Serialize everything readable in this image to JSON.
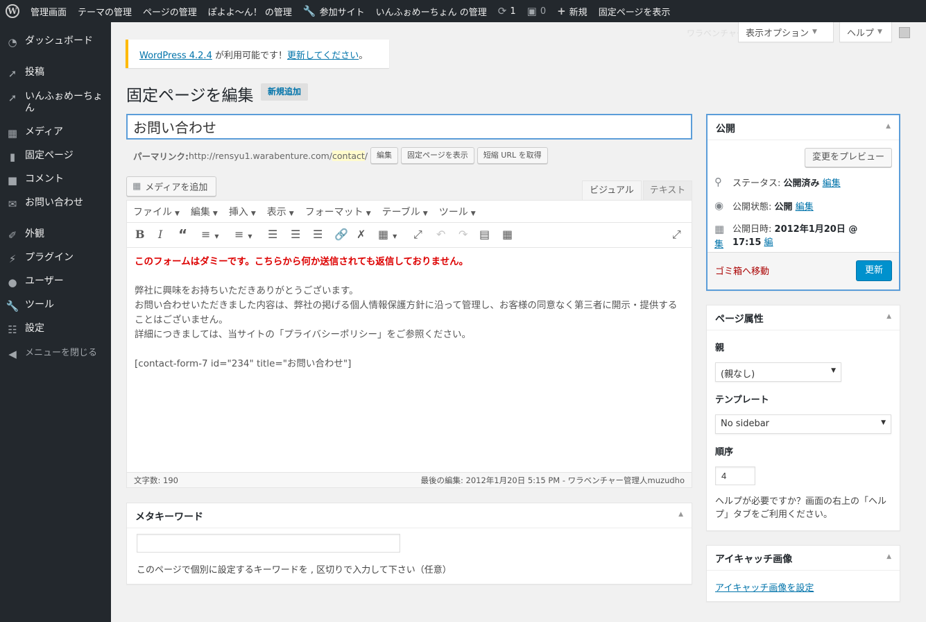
{
  "adminbar": {
    "wp_logo": "W",
    "dashboard": "管理画面",
    "theme": "テーマの管理",
    "pages": "ページの管理",
    "site": "ぽよよ〜ん！ の管理",
    "join": "参加サイト",
    "info": "いんふぉめーちょん の管理",
    "updates_count": "1",
    "comments_count": "0",
    "new": "新規",
    "view_page": "固定ページを表示"
  },
  "screen_options": {
    "label": "表示オプション",
    "help": "ヘルプ",
    "ghost_text": "ワラベンチャー管理人 muzudho さん"
  },
  "sidebar": {
    "items": [
      {
        "label": "ダッシュボード",
        "icon": "dashboard-icon"
      },
      {
        "label": "投稿",
        "icon": "pin-icon"
      },
      {
        "label": "いんふぉめーちょん",
        "icon": "pin-icon"
      },
      {
        "label": "メディア",
        "icon": "media-icon"
      },
      {
        "label": "固定ページ",
        "icon": "page-icon"
      },
      {
        "label": "コメント",
        "icon": "comment-icon"
      },
      {
        "label": "お問い合わせ",
        "icon": "mail-icon"
      },
      {
        "label": "外観",
        "icon": "brush-icon"
      },
      {
        "label": "プラグイン",
        "icon": "plugin-icon"
      },
      {
        "label": "ユーザー",
        "icon": "user-icon"
      },
      {
        "label": "ツール",
        "icon": "wrench-icon"
      },
      {
        "label": "設定",
        "icon": "settings-icon"
      },
      {
        "label": "メニューを閉じる",
        "icon": "collapse-icon"
      }
    ]
  },
  "notice": {
    "link": "WordPress 4.2.4",
    "text": " が利用可能です！",
    "update_link": "更新してください",
    "end": "。"
  },
  "page": {
    "title": "固定ページを編集",
    "add_new": "新規追加"
  },
  "post_title": "お問い合わせ",
  "permalink": {
    "label": "パーマリンク:",
    "base": " http://rensyu1.warabenture.com/",
    "slug": "contact",
    "trail": "/",
    "edit": "編集",
    "view": "固定ページを表示",
    "shortlink": "短縮 URL を取得"
  },
  "editor": {
    "add_media": "メディアを追加",
    "tab_visual": "ビジュアル",
    "tab_text": "テキスト",
    "menus": [
      "ファイル",
      "編集",
      "挿入",
      "表示",
      "フォーマット",
      "テーブル",
      "ツール"
    ],
    "content": {
      "warning": "このフォームはダミーです。こちらから何か送信されても返信しておりません。",
      "line1": "弊社に興味をお持ちいただきありがとうございます。",
      "line2": "お問い合わせいただきました内容は、弊社の掲げる個人情報保護方針に沿って管理し、お客様の同意なく第三者に開示・提供することはございません。",
      "line3": "詳細につきましては、当サイトの「プライバシーポリシー」をご参照ください。",
      "shortcode": "[contact-form-7 id=\"234\" title=\"お問い合わせ\"]"
    },
    "word_count": "文字数: 190",
    "last_edit": "最後の編集: 2012年1月20日 5:15 PM - ワラベンチャー管理人muzudho"
  },
  "meta_keywords": {
    "title": "メタキーワード",
    "input_value": "",
    "help": "このページで個別に設定するキーワードを , 区切りで入力して下さい（任意）"
  },
  "publish": {
    "title": "公開",
    "preview": "変更をプレビュー",
    "status_label": "ステータス:",
    "status_value": "公開済み",
    "visibility_label": "公開状態:",
    "visibility_value": "公開",
    "date_label": "公開日時:",
    "date_value": "2012年1月20日 @ 17:15",
    "edit": "編集",
    "edit_part1": "編",
    "edit_part2": "集",
    "trash": "ゴミ箱へ移動",
    "update": "更新"
  },
  "page_attributes": {
    "title": "ページ属性",
    "parent_label": "親",
    "parent_value": "(親なし)",
    "template_label": "テンプレート",
    "template_value": "No sidebar",
    "order_label": "順序",
    "order_value": "4",
    "help": "ヘルプが必要ですか？画面の右上の「ヘルプ」タブをご利用ください。"
  },
  "featured_image": {
    "title": "アイキャッチ画像",
    "link": "アイキャッチ画像を設定"
  },
  "colors": {
    "accent": "#0073aa",
    "admin_bg": "#23282d",
    "update_btn": "#0091cd",
    "warning_red": "#dd0000"
  }
}
